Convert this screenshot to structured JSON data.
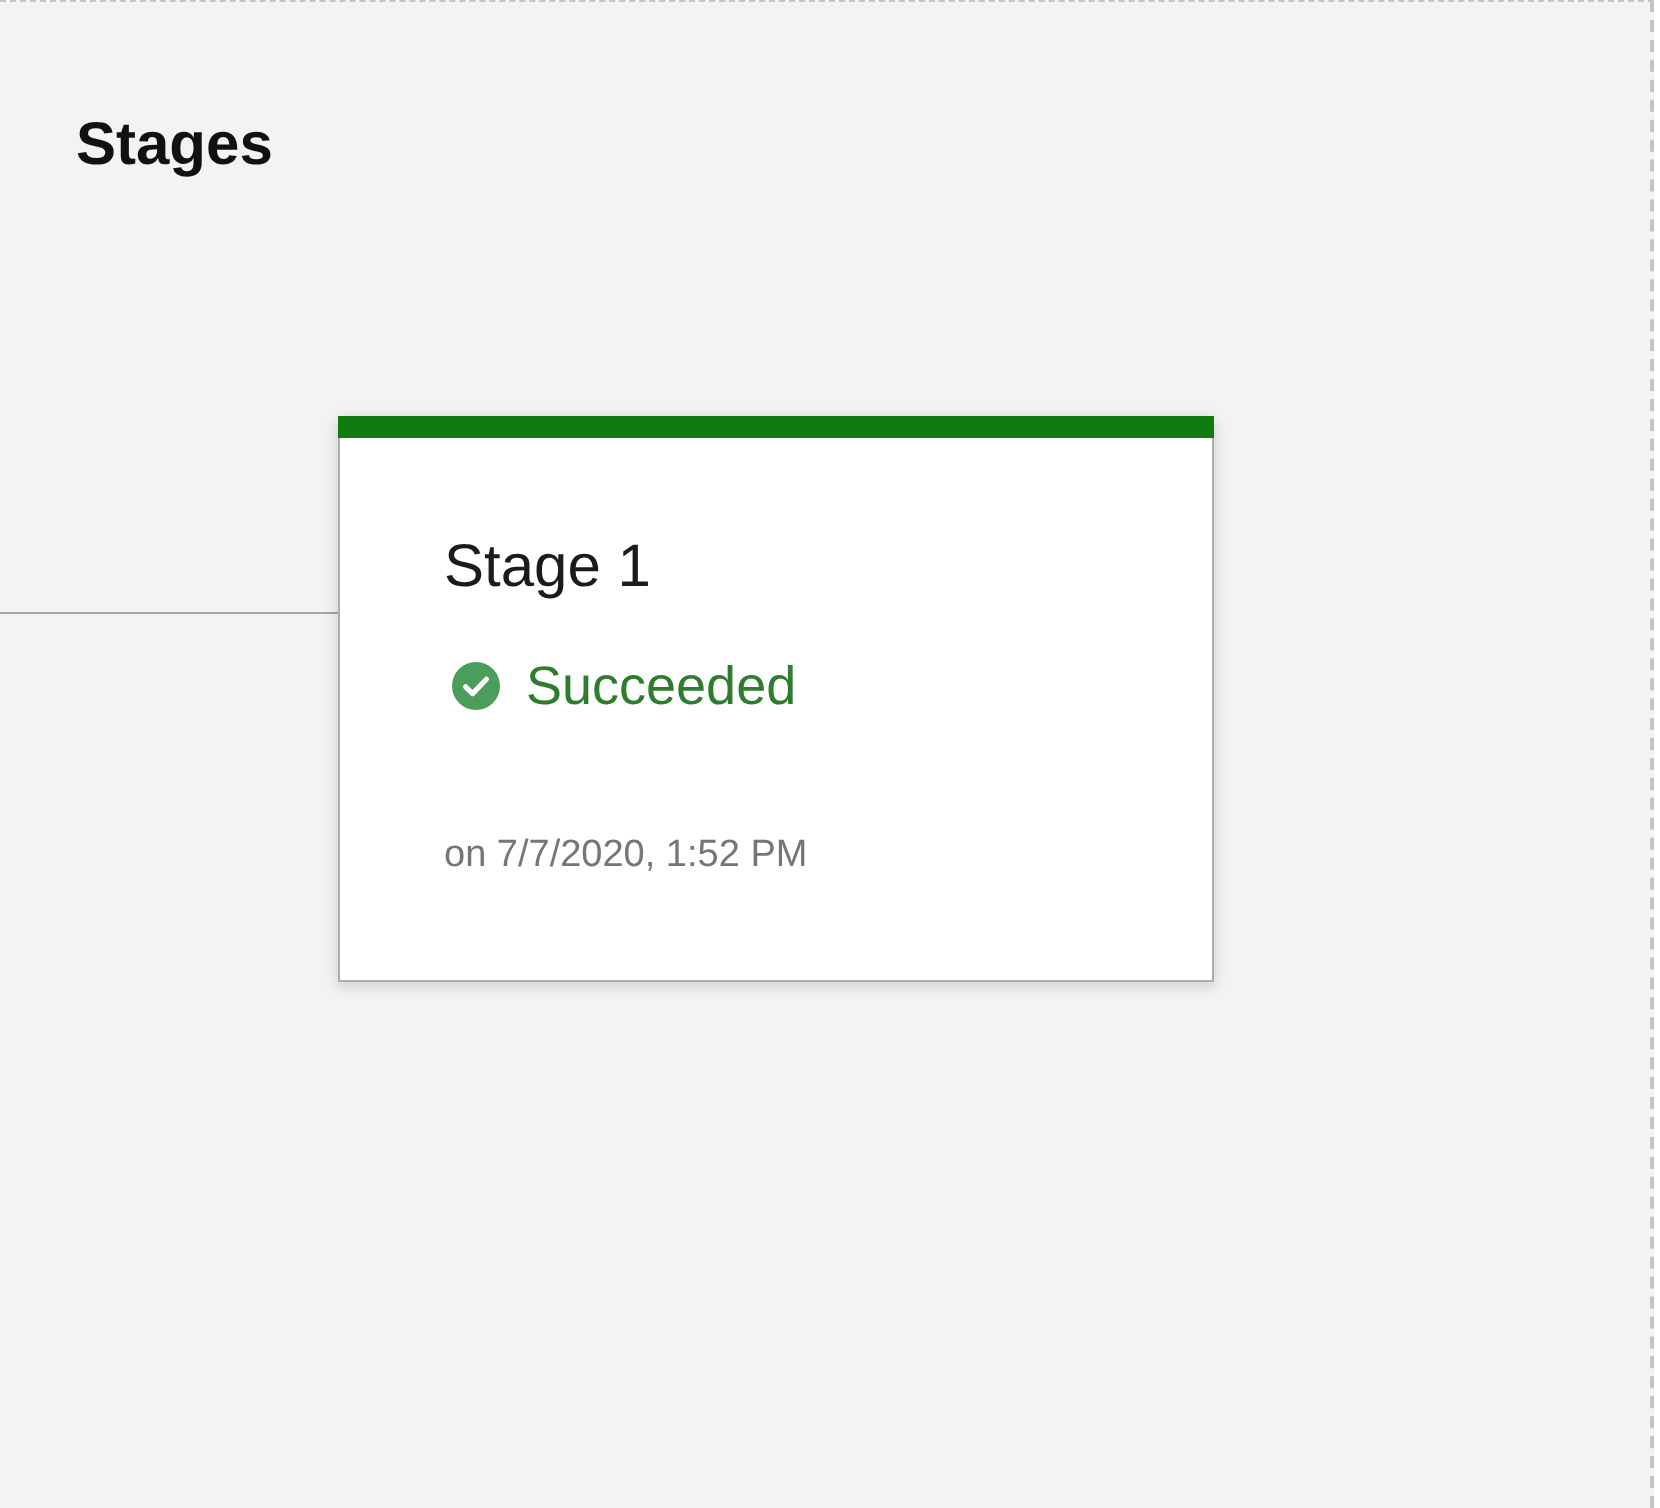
{
  "section": {
    "title": "Stages"
  },
  "stages": [
    {
      "name": "Stage 1",
      "status": {
        "kind": "succeeded",
        "label": "Succeeded"
      },
      "timestamp": "on 7/7/2020, 1:52 PM"
    }
  ]
}
